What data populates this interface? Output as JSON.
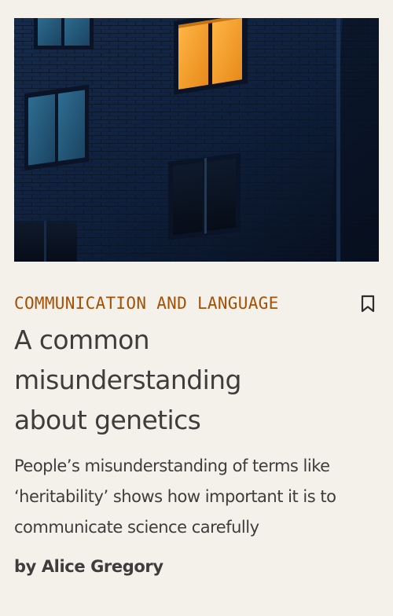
{
  "article": {
    "category": "COMMUNICATION AND LANGUAGE",
    "title": "A common misunderstanding about genetics",
    "standfirst": "People’s misunderstanding of terms like ‘heritability’ shows how important it is to communicate science carefully",
    "byline": "by Alice Gregory"
  },
  "icons": {
    "bookmark": "bookmark-icon"
  },
  "colors": {
    "background": "#f4f1eb",
    "category": "#a35106",
    "text": "#3f3d3b",
    "window_light": "#f3a12c"
  }
}
